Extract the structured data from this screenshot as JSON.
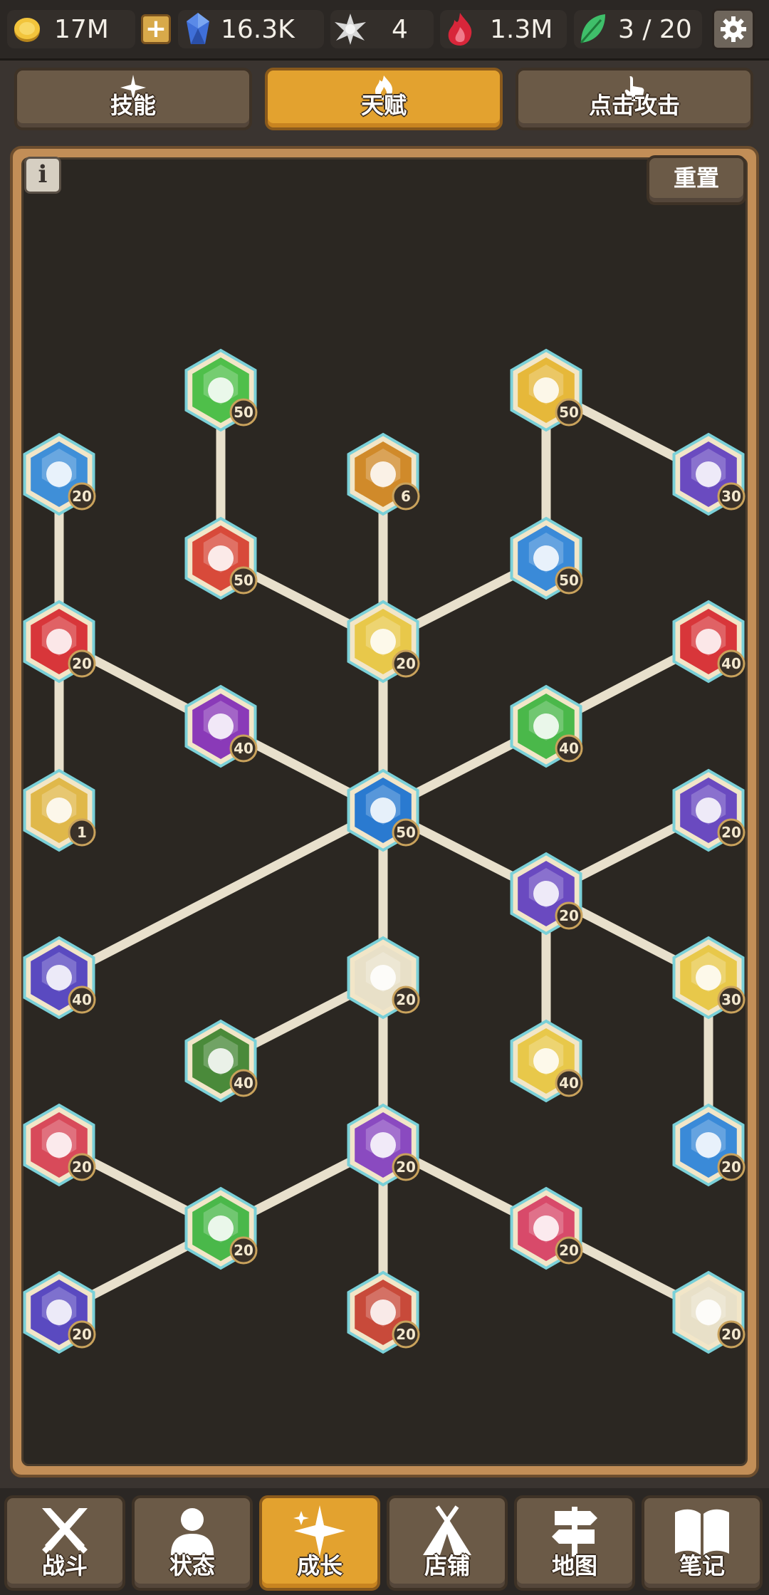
{
  "resources": {
    "gold": "17M",
    "gems": "16.3K",
    "stars": "4",
    "fire": "1.3M",
    "leaves": "3 / 20"
  },
  "tabs": [
    {
      "label": "技能",
      "icon": "sparkle-icon"
    },
    {
      "label": "天赋",
      "icon": "flame-icon",
      "active": true
    },
    {
      "label": "点击攻击",
      "icon": "pointer-hand-icon"
    }
  ],
  "panel": {
    "info_label": "i",
    "reset_label": "重置"
  },
  "talents": [
    {
      "id": "n0",
      "level": "50",
      "color": "#4fbf4a",
      "icon": "muscle-icon"
    },
    {
      "id": "n1",
      "level": "50",
      "color": "#e6b83a",
      "icon": "runner-icon"
    },
    {
      "id": "n2",
      "level": "20",
      "color": "#3f8fd8",
      "icon": "stopwatch-icon"
    },
    {
      "id": "n3",
      "level": "6",
      "color": "#d08a2a",
      "icon": "arrow-up-icon"
    },
    {
      "id": "n4",
      "level": "30",
      "color": "#6a4bc0",
      "icon": "lightning-icon"
    },
    {
      "id": "n5",
      "level": "50",
      "color": "#d84a3a",
      "icon": "fist-icon"
    },
    {
      "id": "n6",
      "level": "50",
      "color": "#3a8ad8",
      "icon": "book-icon"
    },
    {
      "id": "n7",
      "level": "20",
      "color": "#d8363a",
      "icon": "swap-arrows-icon"
    },
    {
      "id": "n8",
      "level": "20",
      "color": "#e8c84a",
      "icon": "glowing-hero-icon"
    },
    {
      "id": "n9",
      "level": "40",
      "color": "#d8363a",
      "icon": "flame-up-icon"
    },
    {
      "id": "n10",
      "level": "40",
      "color": "#8a3ab8",
      "icon": "coins-up-icon"
    },
    {
      "id": "n11",
      "level": "40",
      "color": "#4ab84a",
      "icon": "exp-up-icon"
    },
    {
      "id": "n12",
      "level": "1",
      "color": "#e0b84a",
      "icon": "lock-cycle-icon"
    },
    {
      "id": "n13",
      "level": "50",
      "color": "#2a7ad0",
      "icon": "hero-ascend-icon"
    },
    {
      "id": "n14",
      "level": "20",
      "color": "#6a4ac0",
      "icon": "leaf-up-icon"
    },
    {
      "id": "n15",
      "level": "20",
      "color": "#6a4ac0",
      "icon": "herb-hand-icon"
    },
    {
      "id": "n16",
      "level": "40",
      "color": "#5a4ac0",
      "icon": "exp-coins-icon"
    },
    {
      "id": "n17",
      "level": "20",
      "color": "#e8e0c8",
      "icon": "wanted-poster-icon"
    },
    {
      "id": "n18",
      "level": "30",
      "color": "#e8c84a",
      "icon": "flower-hand-icon"
    },
    {
      "id": "n19",
      "level": "40",
      "color": "#4a8a3a",
      "icon": "target-map-icon"
    },
    {
      "id": "n20",
      "level": "40",
      "color": "#e8c84a",
      "icon": "crystal-up-icon"
    },
    {
      "id": "n21",
      "level": "20",
      "color": "#d84a5a",
      "icon": "diamond-book-icon"
    },
    {
      "id": "n22",
      "level": "20",
      "color": "#8a4ac0",
      "icon": "boss-stats-icon"
    },
    {
      "id": "n23",
      "level": "20",
      "color": "#3a8ad8",
      "icon": "flower-drop-icon"
    },
    {
      "id": "n24",
      "level": "20",
      "color": "#4ab84a",
      "icon": "mushroom-book-icon"
    },
    {
      "id": "n25",
      "level": "20",
      "color": "#d84a6a",
      "icon": "pink-monster-icon"
    },
    {
      "id": "n26",
      "level": "20",
      "color": "#5a4ac0",
      "icon": "ghost-book-icon"
    },
    {
      "id": "n27",
      "level": "20",
      "color": "#c84a3a",
      "icon": "evil-poster-icon"
    },
    {
      "id": "n28",
      "level": "20",
      "color": "#e8e0c8",
      "icon": "goat-book-icon"
    }
  ],
  "nav": [
    {
      "label": "战斗",
      "icon": "crossed-swords-icon"
    },
    {
      "label": "状态",
      "icon": "person-icon"
    },
    {
      "label": "成长",
      "icon": "growth-sparkle-icon",
      "active": true
    },
    {
      "label": "店铺",
      "icon": "tent-icon"
    },
    {
      "label": "地图",
      "icon": "signpost-icon"
    },
    {
      "label": "笔记",
      "icon": "open-book-icon"
    }
  ],
  "colors": {
    "accent": "#e3a22f",
    "panel_frame": "#c28e57",
    "panel_bg": "#2b2722",
    "connector": "#e8e0cc",
    "button": "#6b5a47"
  }
}
